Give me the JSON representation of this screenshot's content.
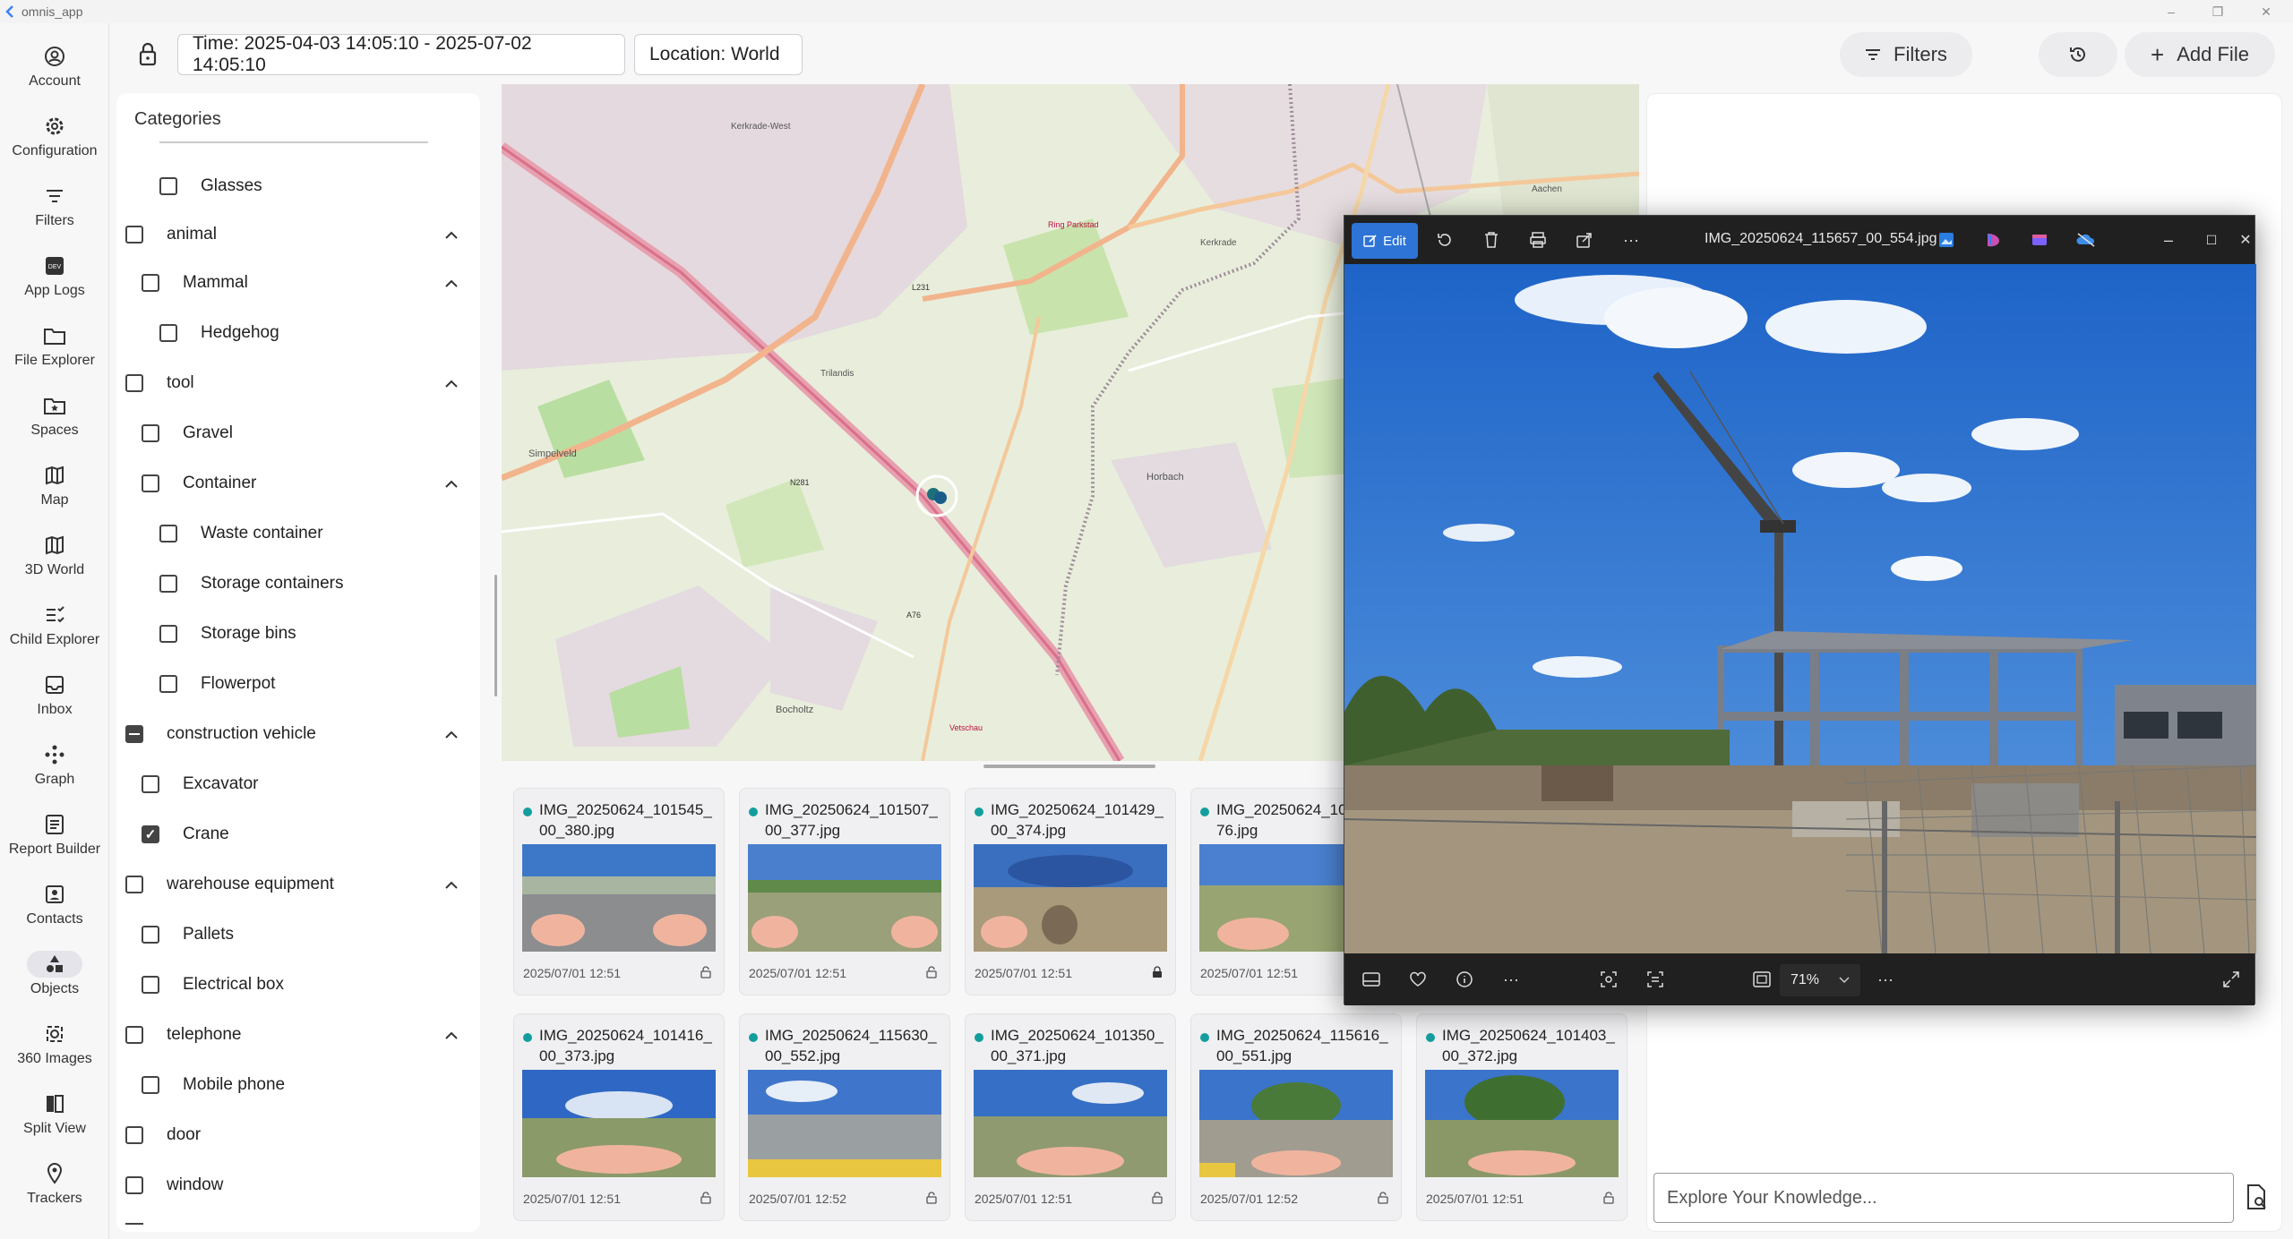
{
  "app": {
    "title": "omnis_app"
  },
  "nav": {
    "items": [
      {
        "label": "Account"
      },
      {
        "label": "Configuration"
      },
      {
        "label": "Filters"
      },
      {
        "label": "App Logs"
      },
      {
        "label": "File Explorer"
      },
      {
        "label": "Spaces"
      },
      {
        "label": "Map"
      },
      {
        "label": "3D World"
      },
      {
        "label": "Child Explorer"
      },
      {
        "label": "Inbox"
      },
      {
        "label": "Graph"
      },
      {
        "label": "Report Builder"
      },
      {
        "label": "Contacts"
      },
      {
        "label": "Objects"
      },
      {
        "label": "360 Images"
      },
      {
        "label": "Split View"
      },
      {
        "label": "Trackers"
      }
    ],
    "active": "Objects"
  },
  "toolbar": {
    "time_filter": "Time: 2025-04-03 14:05:10 - 2025-07-02 14:05:10",
    "location_filter": "Location: World",
    "filters_label": "Filters",
    "add_file_label": "Add File"
  },
  "categories": {
    "title": "Categories",
    "rows": [
      {
        "label": "Glasses",
        "level": 2,
        "state": "unchecked",
        "expandable": false
      },
      {
        "label": "animal",
        "level": 0,
        "state": "unchecked",
        "expandable": true
      },
      {
        "label": "Mammal",
        "level": 1,
        "state": "unchecked",
        "expandable": true
      },
      {
        "label": "Hedgehog",
        "level": 2,
        "state": "unchecked",
        "expandable": false
      },
      {
        "label": "tool",
        "level": 0,
        "state": "unchecked",
        "expandable": true
      },
      {
        "label": "Gravel",
        "level": 1,
        "state": "unchecked",
        "expandable": false
      },
      {
        "label": "Container",
        "level": 1,
        "state": "unchecked",
        "expandable": true
      },
      {
        "label": "Waste container",
        "level": 2,
        "state": "unchecked",
        "expandable": false
      },
      {
        "label": "Storage containers",
        "level": 2,
        "state": "unchecked",
        "expandable": false
      },
      {
        "label": "Storage bins",
        "level": 2,
        "state": "unchecked",
        "expandable": false
      },
      {
        "label": "Flowerpot",
        "level": 2,
        "state": "unchecked",
        "expandable": false
      },
      {
        "label": "construction vehicle",
        "level": 0,
        "state": "indeterminate",
        "expandable": true
      },
      {
        "label": "Excavator",
        "level": 1,
        "state": "unchecked",
        "expandable": false
      },
      {
        "label": "Crane",
        "level": 1,
        "state": "checked",
        "expandable": false
      },
      {
        "label": "warehouse equipment",
        "level": 0,
        "state": "unchecked",
        "expandable": true
      },
      {
        "label": "Pallets",
        "level": 1,
        "state": "unchecked",
        "expandable": false
      },
      {
        "label": "Electrical box",
        "level": 1,
        "state": "unchecked",
        "expandable": false
      },
      {
        "label": "telephone",
        "level": 0,
        "state": "unchecked",
        "expandable": true
      },
      {
        "label": "Mobile phone",
        "level": 1,
        "state": "unchecked",
        "expandable": false
      },
      {
        "label": "door",
        "level": 0,
        "state": "unchecked",
        "expandable": false
      },
      {
        "label": "window",
        "level": 0,
        "state": "unchecked",
        "expandable": false
      }
    ]
  },
  "map": {
    "labels": [
      "Kerkrade-West",
      "Kerkrade",
      "Simpelveld",
      "Bocholtz",
      "Horbach",
      "Trilandis",
      "Vetschau",
      "N281",
      "A76",
      "L231",
      "Ring Parkstad",
      "Aachen"
    ]
  },
  "images": [
    {
      "name": "IMG_20250624_101545_00_380.jpg",
      "date": "2025/07/01 12:51",
      "locked": false
    },
    {
      "name": "IMG_20250624_101507_00_377.jpg",
      "date": "2025/07/01 12:51",
      "locked": false
    },
    {
      "name": "IMG_20250624_101429_00_374.jpg",
      "date": "2025/07/01 12:51",
      "locked": true
    },
    {
      "name": "IMG_20250624_101...0_376.jpg",
      "date": "2025/07/01 12:51",
      "locked": false
    },
    {
      "name": "IMG_20250624_101416_00_373.jpg",
      "date": "2025/07/01 12:51",
      "locked": false
    },
    {
      "name": "IMG_20250624_115630_00_552.jpg",
      "date": "2025/07/01 12:52",
      "locked": false
    },
    {
      "name": "IMG_20250624_101350_00_371.jpg",
      "date": "2025/07/01 12:51",
      "locked": false
    },
    {
      "name": "IMG_20250624_115616_00_551.jpg",
      "date": "2025/07/01 12:52",
      "locked": false
    },
    {
      "name": "IMG_20250624_101403_00_372.jpg",
      "date": "2025/07/01 12:51",
      "locked": false
    }
  ],
  "viewer": {
    "edit_label": "Edit",
    "file_name": "IMG_20250624_115657_00_554.jpg",
    "zoom": "71%"
  },
  "explore": {
    "placeholder": "Explore Your Knowledge..."
  },
  "colors": {
    "accent": "#2e74d6",
    "status_dot": "#139e9e"
  }
}
